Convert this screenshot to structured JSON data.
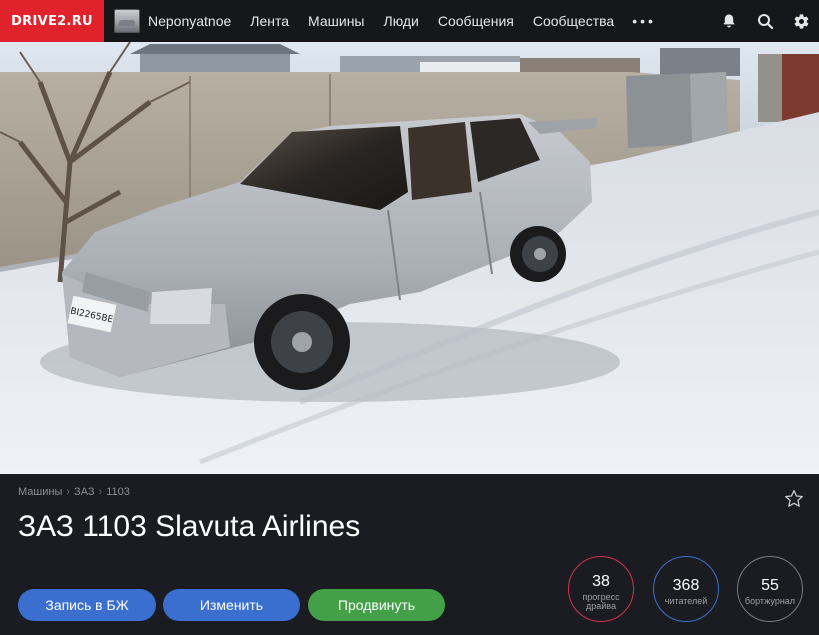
{
  "brand": {
    "logo_text": "DRIVE2.RU",
    "accent": "#e0222c"
  },
  "nav": {
    "username": "Neponyatnoe",
    "items": [
      {
        "label": "Лента"
      },
      {
        "label": "Машины"
      },
      {
        "label": "Люди"
      },
      {
        "label": "Сообщения"
      },
      {
        "label": "Сообщества"
      }
    ],
    "more_label": "•••",
    "icons": [
      "bell-icon",
      "search-icon",
      "gear-icon"
    ]
  },
  "car": {
    "plate": "ВІ2265ВЕ",
    "breadcrumb": [
      "Машины",
      "ЗАЗ",
      "1103"
    ],
    "breadcrumb_sep": "›",
    "title": "ЗАЗ 1103 Slavuta Airlines"
  },
  "actions": {
    "diary_label": "Запись в БЖ",
    "edit_label": "Изменить",
    "promote_label": "Продвинуть",
    "colors": {
      "primary": "#3a6fcf",
      "promote": "#43a047"
    }
  },
  "stats": [
    {
      "value": "38",
      "label": "прогресс драйва",
      "color": "#d0344e"
    },
    {
      "value": "368",
      "label": "читателей",
      "color": "#3a6fcf"
    },
    {
      "value": "55",
      "label": "бортжурнал",
      "color": "#777b82"
    }
  ]
}
